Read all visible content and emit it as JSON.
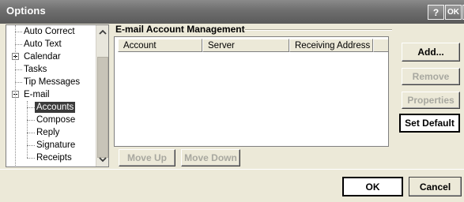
{
  "window": {
    "title": "Options",
    "help_label": "?",
    "ok_label": "OK",
    "close_label": "×"
  },
  "nav": {
    "items": [
      {
        "label": "Auto Correct",
        "level": 0,
        "expander": "none",
        "selected": false
      },
      {
        "label": "Auto Text",
        "level": 0,
        "expander": "none",
        "selected": false
      },
      {
        "label": "Calendar",
        "level": 0,
        "expander": "plus",
        "selected": false
      },
      {
        "label": "Tasks",
        "level": 0,
        "expander": "none",
        "selected": false
      },
      {
        "label": "Tip Messages",
        "level": 0,
        "expander": "none",
        "selected": false
      },
      {
        "label": "E-mail",
        "level": 0,
        "expander": "minus",
        "selected": false
      },
      {
        "label": "Accounts",
        "level": 1,
        "expander": "none",
        "selected": true
      },
      {
        "label": "Compose",
        "level": 1,
        "expander": "none",
        "selected": false
      },
      {
        "label": "Reply",
        "level": 1,
        "expander": "none",
        "selected": false
      },
      {
        "label": "Signature",
        "level": 1,
        "expander": "none",
        "selected": false
      },
      {
        "label": "Receipts",
        "level": 1,
        "expander": "none",
        "selected": false
      }
    ],
    "scrollbar": {
      "up_icon": "chevron-up-icon",
      "down_icon": "chevron-down-icon"
    }
  },
  "main": {
    "section_title": "E-mail Account Management",
    "columns": [
      "Account",
      "Server",
      "Receiving Address"
    ],
    "rows": [],
    "move_up_label": "Move Up",
    "move_down_label": "Move Down"
  },
  "side_buttons": {
    "add_label": "Add...",
    "remove_label": "Remove",
    "properties_label": "Properties",
    "set_default_label": "Set Default"
  },
  "footer": {
    "ok_label": "OK",
    "cancel_label": "Cancel"
  },
  "colors": {
    "titlebar": "#6e6e6e",
    "selection": "#3a3a3a",
    "dialog_bg": "#ece9d8",
    "disabled_text": "#a8a8a0"
  }
}
